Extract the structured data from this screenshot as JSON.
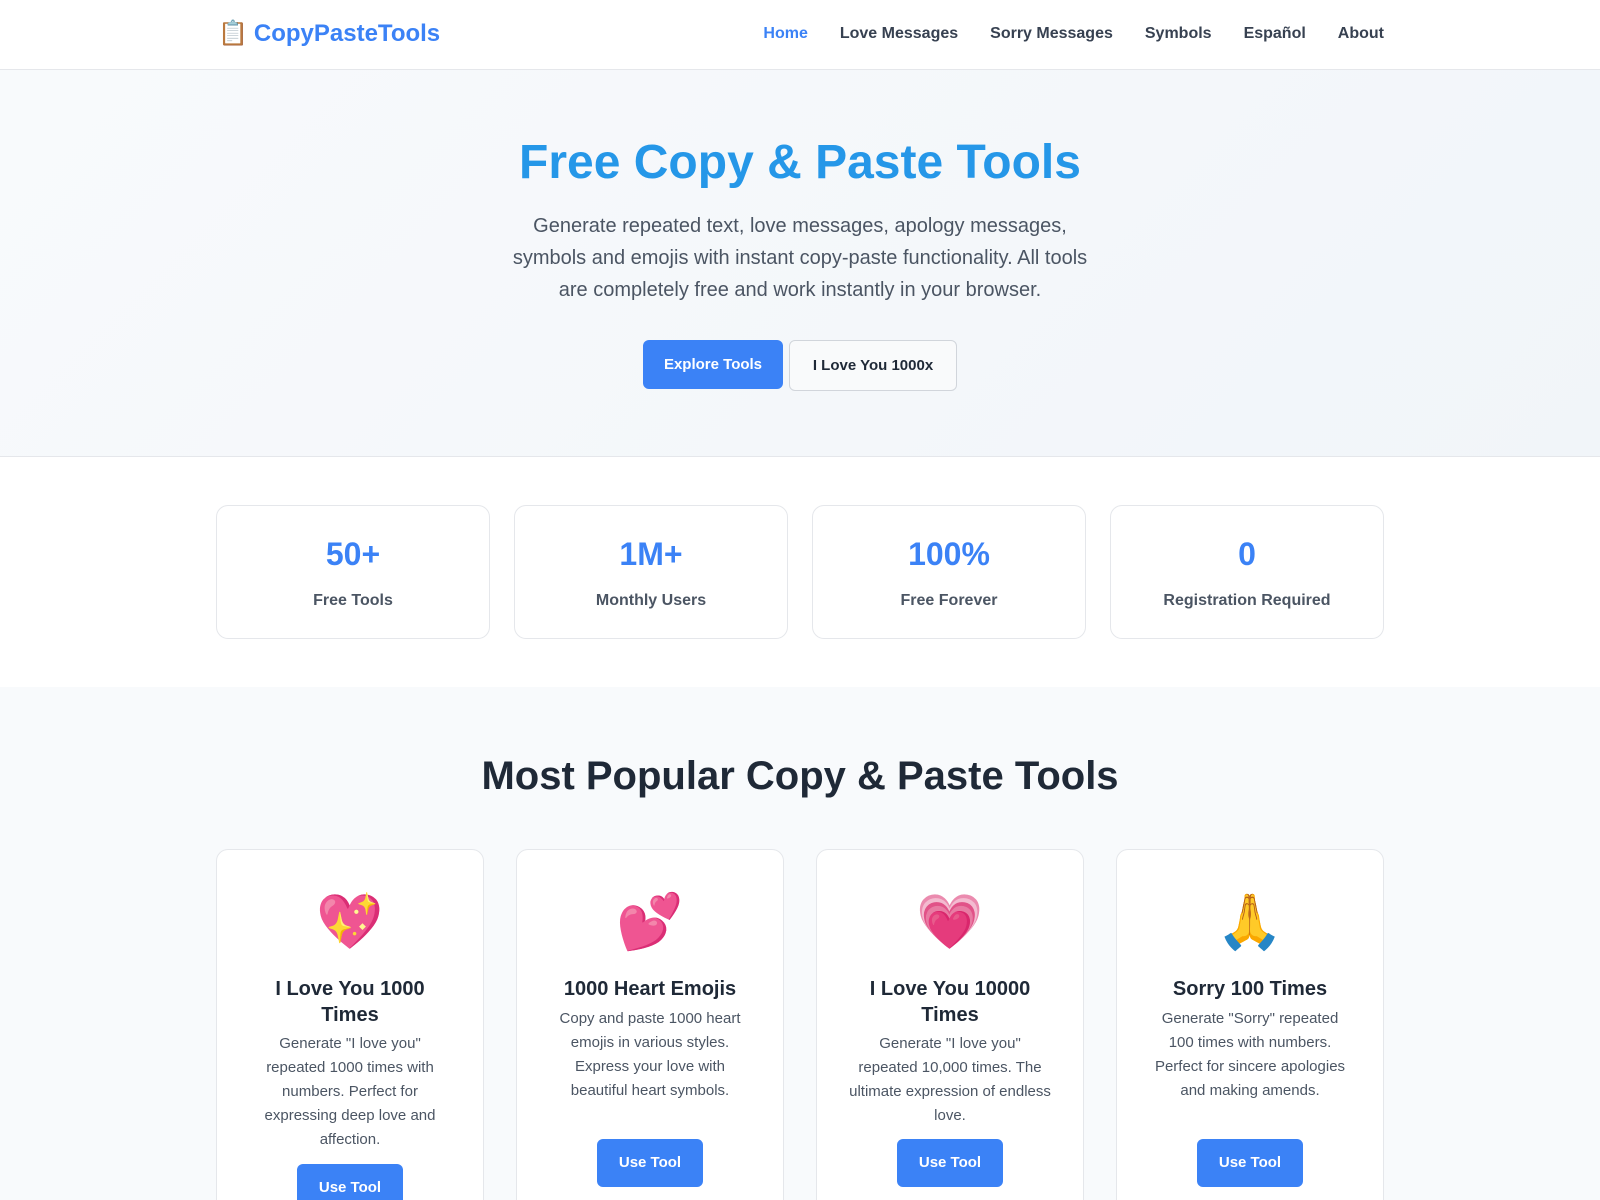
{
  "header": {
    "brand_icon": "📋",
    "brand_name": "CopyPasteTools",
    "nav": [
      {
        "label": "Home",
        "active": true
      },
      {
        "label": "Love Messages"
      },
      {
        "label": "Sorry Messages"
      },
      {
        "label": "Symbols"
      },
      {
        "label": "Español"
      },
      {
        "label": "About"
      }
    ]
  },
  "hero": {
    "title": "Free Copy & Paste Tools",
    "description": "Generate repeated text, love messages, apology messages, symbols and emojis with instant copy-paste functionality. All tools are completely free and work instantly in your browser.",
    "primary_button": "Explore Tools",
    "secondary_button": "I Love You 1000x"
  },
  "stats": [
    {
      "value": "50+",
      "label": "Free Tools"
    },
    {
      "value": "1M+",
      "label": "Monthly Users"
    },
    {
      "value": "100%",
      "label": "Free Forever"
    },
    {
      "value": "0",
      "label": "Registration Required"
    }
  ],
  "tools": {
    "title": "Most Popular Copy & Paste Tools",
    "items": [
      {
        "icon": "💖",
        "icon_name": "sparkling-heart-icon",
        "name": "I Love You 1000 Times",
        "description": "Generate \"I love you\" repeated 1000 times with numbers. Perfect for expressing deep love and affection.",
        "button": "Use Tool"
      },
      {
        "icon": "💕",
        "icon_name": "two-hearts-icon",
        "name": "1000 Heart Emojis",
        "description": "Copy and paste 1000 heart emojis in various styles. Express your love with beautiful heart symbols.",
        "button": "Use Tool"
      },
      {
        "icon": "💗",
        "icon_name": "growing-heart-icon",
        "name": "I Love You 10000 Times",
        "description": "Generate \"I love you\" repeated 10,000 times. The ultimate expression of endless love.",
        "button": "Use Tool"
      },
      {
        "icon": "🙏",
        "icon_name": "folded-hands-icon",
        "name": "Sorry 100 Times",
        "description": "Generate \"Sorry\" repeated 100 times with numbers. Perfect for sincere apologies and making amends.",
        "button": "Use Tool"
      }
    ]
  }
}
